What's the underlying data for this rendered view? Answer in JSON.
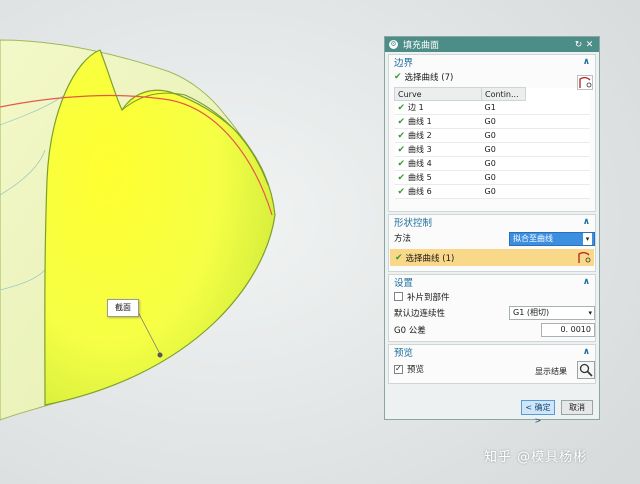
{
  "viewport": {
    "callout_label": "截面"
  },
  "dialog": {
    "title": "填充曲面",
    "boundary": {
      "header": "边界",
      "select_label": "选择曲线 (7)",
      "table": {
        "columns": [
          "Curve",
          "Contin..."
        ],
        "rows": [
          {
            "curve": "边 1",
            "cont": "G1"
          },
          {
            "curve": "曲线 1",
            "cont": "G0"
          },
          {
            "curve": "曲线 2",
            "cont": "G0"
          },
          {
            "curve": "曲线 3",
            "cont": "G0"
          },
          {
            "curve": "曲线 4",
            "cont": "G0"
          },
          {
            "curve": "曲线 5",
            "cont": "G0"
          },
          {
            "curve": "曲线 6",
            "cont": "G0"
          }
        ]
      }
    },
    "shape_control": {
      "header": "形状控制",
      "method_label": "方法",
      "method_value": "拟合至曲线",
      "select_label": "选择曲线 (1)"
    },
    "settings": {
      "header": "设置",
      "patch_label": "补片到部件",
      "continuity_label": "默认边连续性",
      "continuity_value": "G1 (相切)",
      "tolerance_label": "G0 公差",
      "tolerance_value": "0. 0010"
    },
    "preview": {
      "header": "预览",
      "preview_label": "预览",
      "show_result_label": "显示结果"
    },
    "ok_label": "< 确定 >",
    "cancel_label": "取消"
  },
  "watermark": "知乎 @模具杨彬",
  "colors": {
    "title_bar": "#4c8d88",
    "section_header": "#1f6f9e",
    "surface_fill": "#f2ff5a",
    "highlight_row": "#f9d88a",
    "method_select": "#3b8ee0"
  }
}
